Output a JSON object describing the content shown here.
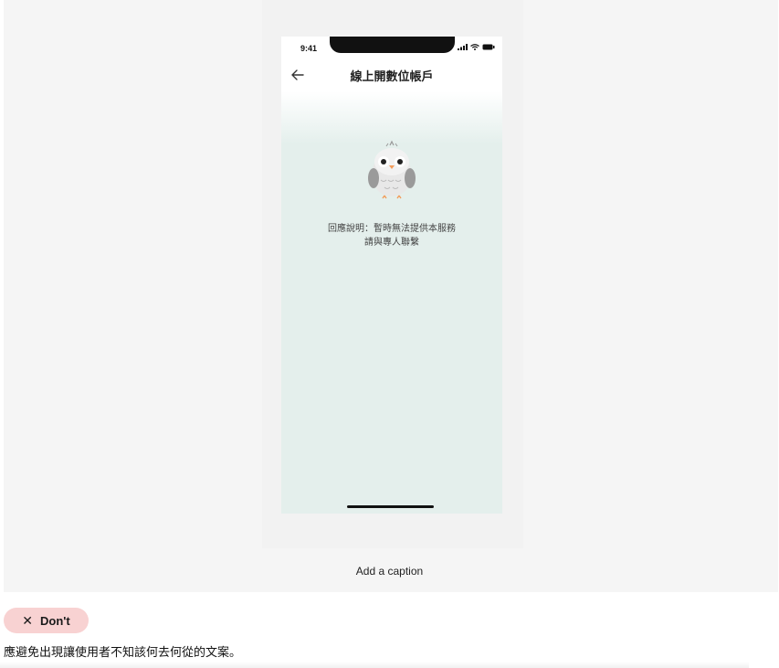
{
  "phone": {
    "status_time": "9:41",
    "nav_title": "線上開數位帳戶",
    "message_line1": "回應說明：暫時無法提供本服務",
    "message_line2": "請與專人聯繫",
    "icons": [
      "back-arrow-icon",
      "signal-icon",
      "wifi-icon",
      "battery-icon",
      "owl-mascot-icon"
    ]
  },
  "caption": "Add a caption",
  "badge": {
    "icon": "close-icon",
    "label": "Don't"
  },
  "description": "應避免出現讓使用者不知該何去何從的文案。",
  "colors": {
    "badge_bg": "#f8d2d2",
    "phone_bg": "#e4efec",
    "canvas_bg": "#f5f5f5"
  }
}
